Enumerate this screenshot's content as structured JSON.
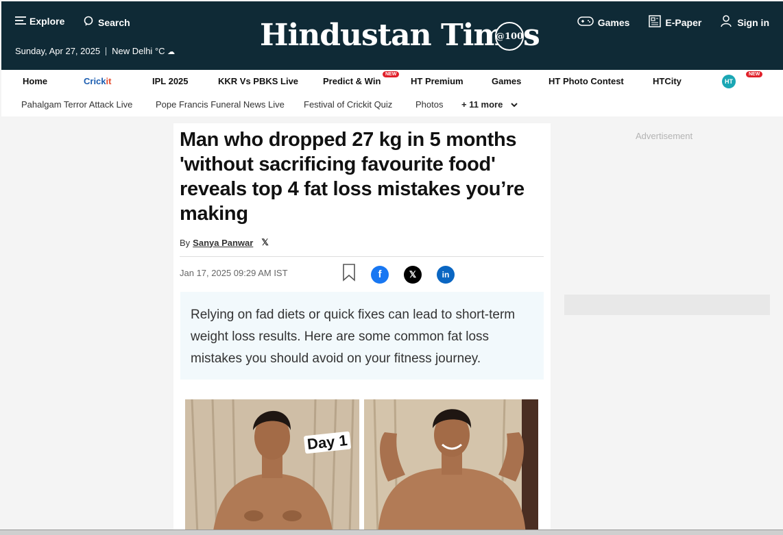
{
  "header": {
    "explore": "Explore",
    "search": "Search",
    "date": "Sunday, Apr 27, 2025",
    "city": "New Delhi",
    "temp_unit": "°C",
    "logo": "Hindustan Times",
    "seal": "@100",
    "games": "Games",
    "epaper": "E-Paper",
    "signin": "Sign in"
  },
  "nav_primary": {
    "home": "Home",
    "cricket_a": "Crick",
    "cricket_b": "it",
    "ipl": "IPL 2025",
    "kkr": "KKR Vs PBKS Live",
    "predict": "Predict & Win",
    "premium": "HT Premium",
    "games": "Games",
    "photo_contest": "HT Photo Contest",
    "htcity": "HTCity",
    "ht_badge": "HT",
    "new_badge": "NEW"
  },
  "nav_secondary": {
    "pahalgam": "Pahalgam Terror Attack Live",
    "pope": "Pope Francis Funeral News Live",
    "festival": "Festival of Crickit Quiz",
    "photos": "Photos",
    "more": "+ 11 more"
  },
  "article": {
    "headline": "Man who dropped 27 kg in 5 months 'without sacrificing favourite food' reveals top 4 fat loss mistakes you’re making",
    "by": "By",
    "author": "Sanya Panwar",
    "timestamp": "Jan 17, 2025 09:29 AM IST",
    "summary": "Relying on fad diets or quick fixes can lead to short-term weight loss results. Here are some common fat loss mistakes you should avoid on your fitness journey.",
    "photo_label": "Day 1"
  },
  "sidebar": {
    "ad_label": "Advertisement"
  },
  "colors": {
    "header_bg": "#0f2a36",
    "facebook": "#1877f2",
    "linkedin": "#0a66c2",
    "summary_bg": "#f2f9fc",
    "new_badge": "#e0202a"
  }
}
